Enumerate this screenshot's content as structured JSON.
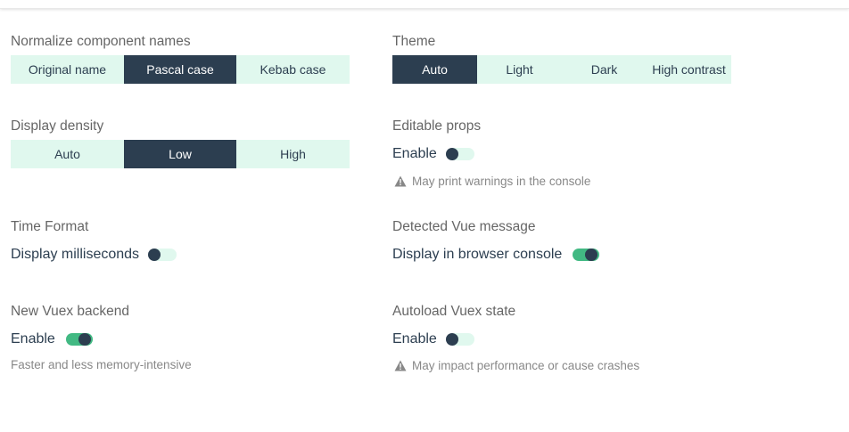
{
  "colors": {
    "accent": "#42b983",
    "dark": "#2c3e50",
    "light": "#e0f8ee",
    "muted": "#888888"
  },
  "normalize": {
    "title": "Normalize component names",
    "options": [
      "Original name",
      "Pascal case",
      "Kebab case"
    ],
    "selected": "Pascal case"
  },
  "theme": {
    "title": "Theme",
    "options": [
      "Auto",
      "Light",
      "Dark",
      "High contrast"
    ],
    "selected": "Auto"
  },
  "density": {
    "title": "Display density",
    "options": [
      "Auto",
      "Low",
      "High"
    ],
    "selected": "Low"
  },
  "editable_props": {
    "title": "Editable props",
    "toggle_label": "Enable",
    "enabled": false,
    "warning_icon": "warning-triangle-icon",
    "warning": "May print warnings in the console"
  },
  "time_format": {
    "title": "Time Format",
    "toggle_label": "Display milliseconds",
    "enabled": false
  },
  "detected_vue": {
    "title": "Detected Vue message",
    "toggle_label": "Display in browser console",
    "enabled": true
  },
  "vuex_backend": {
    "title": "New Vuex backend",
    "toggle_label": "Enable",
    "enabled": true,
    "hint": "Faster and less memory-intensive"
  },
  "autoload_vuex": {
    "title": "Autoload Vuex state",
    "toggle_label": "Enable",
    "enabled": false,
    "warning_icon": "warning-triangle-icon",
    "warning": "May impact performance or cause crashes"
  }
}
